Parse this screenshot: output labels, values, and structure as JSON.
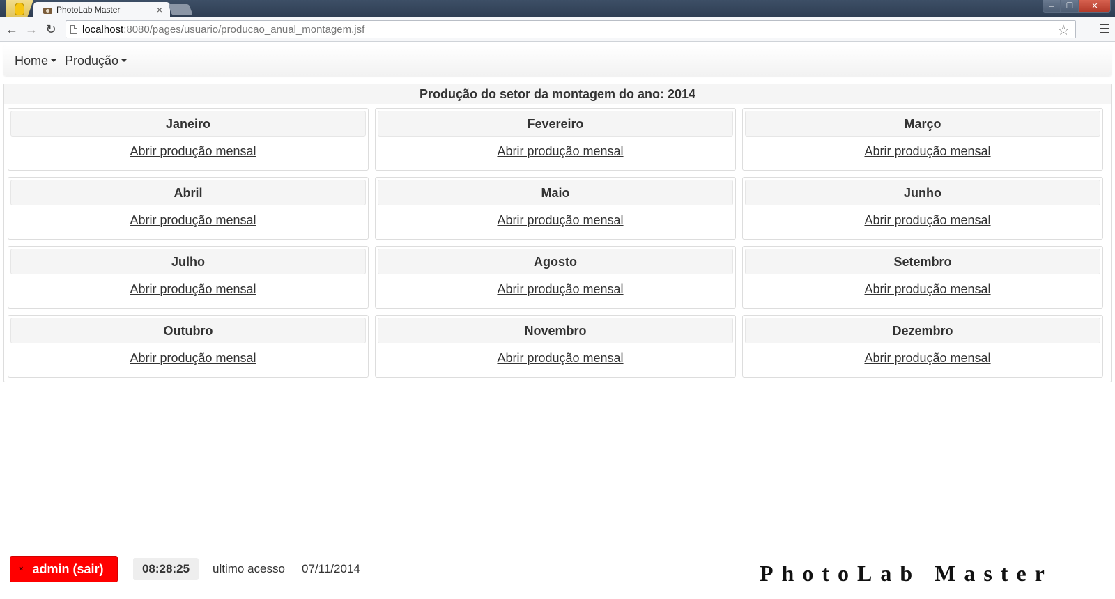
{
  "browser": {
    "tab_title": "PhotoLab Master",
    "tab_close": "×",
    "url_host": "localhost",
    "url_rest": ":8080/pages/usuario/producao_anual_montagem.jsf",
    "back_icon": "back-arrow-icon",
    "forward_icon": "forward-arrow-icon",
    "reload_icon": "reload-icon",
    "bookmark_icon": "star-icon",
    "menu_icon": "hamburger-menu-icon"
  },
  "navbar": {
    "menus": [
      {
        "label": "Home"
      },
      {
        "label": "Produção"
      }
    ]
  },
  "panel": {
    "title": "Produção do setor da montagem do ano: 2014",
    "months": [
      {
        "name": "Janeiro",
        "link": "Abrir produção mensal"
      },
      {
        "name": "Fevereiro",
        "link": "Abrir produção mensal"
      },
      {
        "name": "Março",
        "link": "Abrir produção mensal"
      },
      {
        "name": "Abril",
        "link": "Abrir produção mensal"
      },
      {
        "name": "Maio",
        "link": "Abrir produção mensal"
      },
      {
        "name": "Junho",
        "link": "Abrir produção mensal"
      },
      {
        "name": "Julho",
        "link": "Abrir produção mensal"
      },
      {
        "name": "Agosto",
        "link": "Abrir produção mensal"
      },
      {
        "name": "Setembro",
        "link": "Abrir produção mensal"
      },
      {
        "name": "Outubro",
        "link": "Abrir produção mensal"
      },
      {
        "name": "Novembro",
        "link": "Abrir produção mensal"
      },
      {
        "name": "Dezembro",
        "link": "Abrir produção mensal"
      }
    ]
  },
  "footer": {
    "logout_label": "admin (sair)",
    "logout_x": "×",
    "clock": "08:28:25",
    "last_access_label": "ultimo acesso",
    "last_access_date": "07/11/2014",
    "logo_text": "PhotoLab Master"
  },
  "colors": {
    "logout_bg": "#ff0000",
    "panel_heading_bg": "#f5f5f5",
    "titlebar_bg": "#2e3d52"
  }
}
